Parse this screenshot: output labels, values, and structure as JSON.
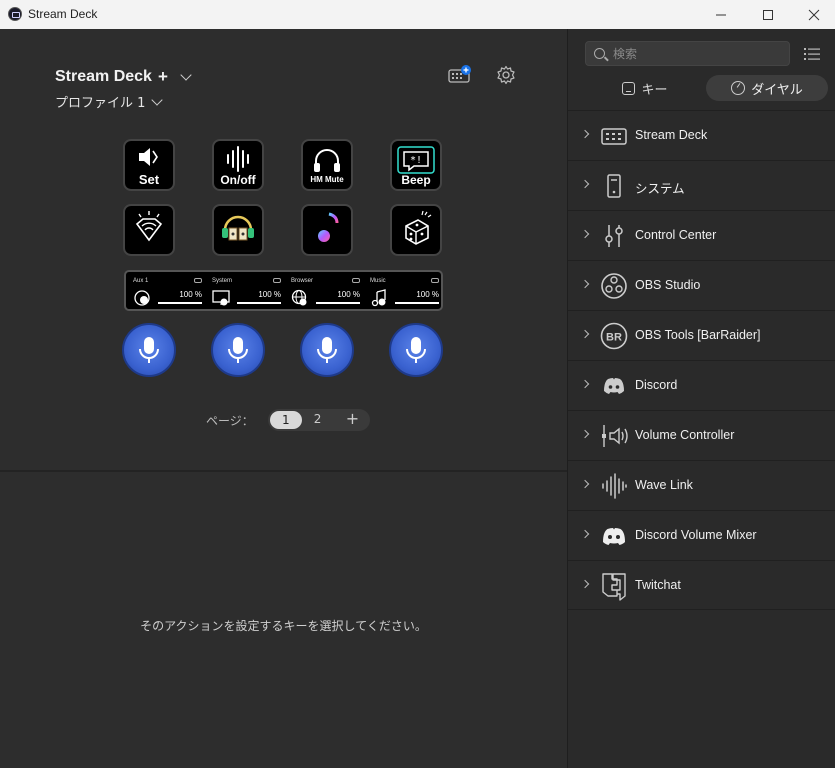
{
  "window": {
    "title": "Stream Deck",
    "minimize": "—",
    "maximize": "☐",
    "close": "✕"
  },
  "device": {
    "name": "Stream Deck",
    "add": "+",
    "profile": "プロファイル 1"
  },
  "keys": [
    {
      "label": "Set",
      "icon": "speaker-arrows-icon"
    },
    {
      "label": "On/off",
      "icon": "waveform-icon"
    },
    {
      "label": "HM Mute",
      "icon": "headphones-icon"
    },
    {
      "label": "Beep",
      "icon": "beep-bubble-icon"
    },
    {
      "label": "",
      "icon": "wifi-gem-icon"
    },
    {
      "label": "",
      "icon": "audiobook-icon"
    },
    {
      "label": "",
      "icon": "music-note-icon"
    },
    {
      "label": "",
      "icon": "dice-icon"
    }
  ],
  "touch_strip": [
    {
      "label": "Aux 1",
      "percent": "100 %",
      "level": 1.0
    },
    {
      "label": "System",
      "percent": "100 %",
      "level": 1.0
    },
    {
      "label": "Browser",
      "percent": "100 %",
      "level": 1.0
    },
    {
      "label": "Music",
      "percent": "100 %",
      "level": 1.0
    }
  ],
  "dials": [
    "microphone-icon",
    "microphone-icon",
    "microphone-icon",
    "microphone-icon"
  ],
  "pager": {
    "label": "ページ：",
    "pages": [
      "1",
      "2"
    ],
    "active": "1",
    "add": "+"
  },
  "hint": "そのアクションを設定するキーを選択してください。",
  "sidebar": {
    "search_placeholder": "検索",
    "tabs": {
      "keys": "キー",
      "dial": "ダイヤル"
    },
    "categories": [
      {
        "label": "Stream Deck",
        "icon": "stream-deck-icon"
      },
      {
        "label": "システム",
        "icon": "system-icon"
      },
      {
        "label": "Control Center",
        "icon": "sliders-icon"
      },
      {
        "label": "OBS Studio",
        "icon": "obs-icon"
      },
      {
        "label": "OBS Tools [BarRaider]",
        "icon": "barraider-icon"
      },
      {
        "label": "Discord",
        "icon": "discord-icon"
      },
      {
        "label": "Volume Controller",
        "icon": "volume-controller-icon"
      },
      {
        "label": "Wave Link",
        "icon": "wave-link-icon"
      },
      {
        "label": "Discord Volume Mixer",
        "icon": "discord-mixer-icon"
      },
      {
        "label": "Twitchat",
        "icon": "twitchat-icon"
      }
    ]
  }
}
